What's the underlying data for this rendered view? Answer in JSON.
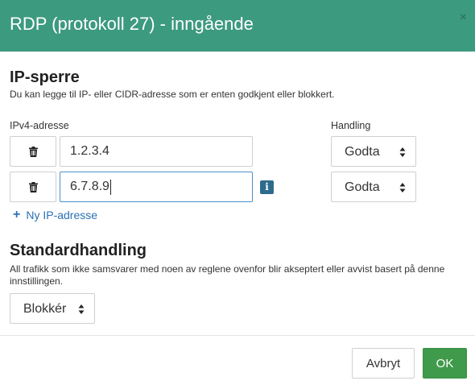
{
  "dialog": {
    "title": "RDP (protokoll 27) - inngående",
    "close_glyph": "×"
  },
  "ip_block": {
    "heading": "IP-sperre",
    "description": "Du kan legge til IP- eller CIDR-adresse som er enten godkjent eller blokkert.",
    "address_label": "IPv4-adresse",
    "action_label": "Handling",
    "rows": [
      {
        "address": "1.2.3.4",
        "action": "Godta"
      },
      {
        "address": "6.7.8.9",
        "action": "Godta"
      }
    ],
    "add_label": "Ny IP-adresse",
    "icons": {
      "delete": "trash-icon",
      "info": "info-icon",
      "add": "plus-icon",
      "select": "sort-arrows-icon"
    }
  },
  "default_action": {
    "heading": "Standardhandling",
    "description": "All trafikk som ikke samsvarer med noen av reglene ovenfor blir akseptert eller avvist basert på denne innstillingen.",
    "value": "Blokkér"
  },
  "footer": {
    "cancel_label": "Avbryt",
    "ok_label": "OK"
  },
  "colors": {
    "header": "#3c9a7e",
    "ok_button": "#3f9a4c",
    "link": "#2a72b5",
    "info": "#2d6b8d",
    "focus": "#4a90c9"
  }
}
